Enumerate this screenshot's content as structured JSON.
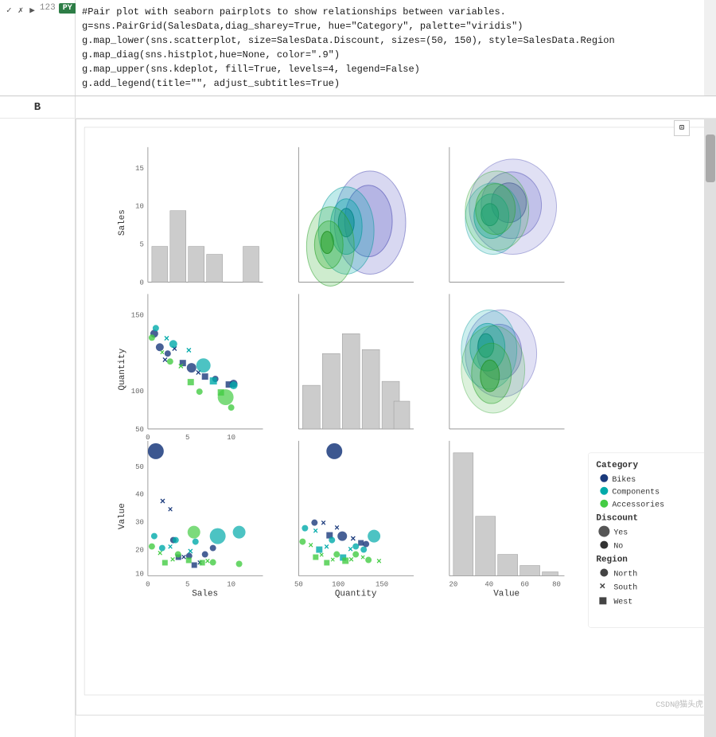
{
  "cell": {
    "controls": [
      "✓",
      "✗",
      "▶"
    ],
    "number": "123",
    "py_label": "PY",
    "code_lines": [
      "#Pair plot with seaborn pairplots to show relationships between variables.",
      "g=sns.PairGrid(SalesData,diag_sharey=True, hue=\"Category\", palette=\"viridis\")",
      "g.map_lower(sns.scatterplot, size=SalesData.Discount, sizes=(50, 150), style=SalesData.Region",
      "g.map_diag(sns.histplot,hue=None, color=\".9\")",
      "g.map_upper(sns.kdeplot, fill=True, levels=4, legend=False)",
      "g.add_legend(title=\"\", adjust_subtitles=True)"
    ],
    "output_label": "B"
  },
  "legend": {
    "category_title": "Category",
    "categories": [
      {
        "name": "Bikes",
        "color": "#1a3a7c"
      },
      {
        "name": "Components",
        "color": "#00aaaa"
      },
      {
        "name": "Accessories",
        "color": "#44cc44"
      }
    ],
    "discount_title": "Discount",
    "discounts": [
      {
        "name": "Yes"
      },
      {
        "name": "No"
      }
    ],
    "region_title": "Region",
    "regions": [
      {
        "name": "North",
        "symbol": "●"
      },
      {
        "name": "South",
        "symbol": "✕"
      },
      {
        "name": "West",
        "symbol": "■"
      }
    ]
  },
  "axes": {
    "x_labels": [
      "Sales",
      "Quantity",
      "Value"
    ],
    "y_labels": [
      "Sales",
      "Quantity",
      "Value"
    ],
    "sales_ticks": [
      "0",
      "5",
      "10"
    ],
    "quantity_ticks": [
      "50",
      "100",
      "150"
    ],
    "value_ticks": [
      "20",
      "40",
      "60",
      "80"
    ],
    "sales_y_ticks": [
      "0",
      "5",
      "10",
      "15"
    ],
    "quantity_y_ticks": [
      "50",
      "100",
      "150"
    ],
    "value_y_ticks": [
      "20",
      "30",
      "40",
      "50"
    ]
  },
  "watermark": "CSDN@猫头虎"
}
